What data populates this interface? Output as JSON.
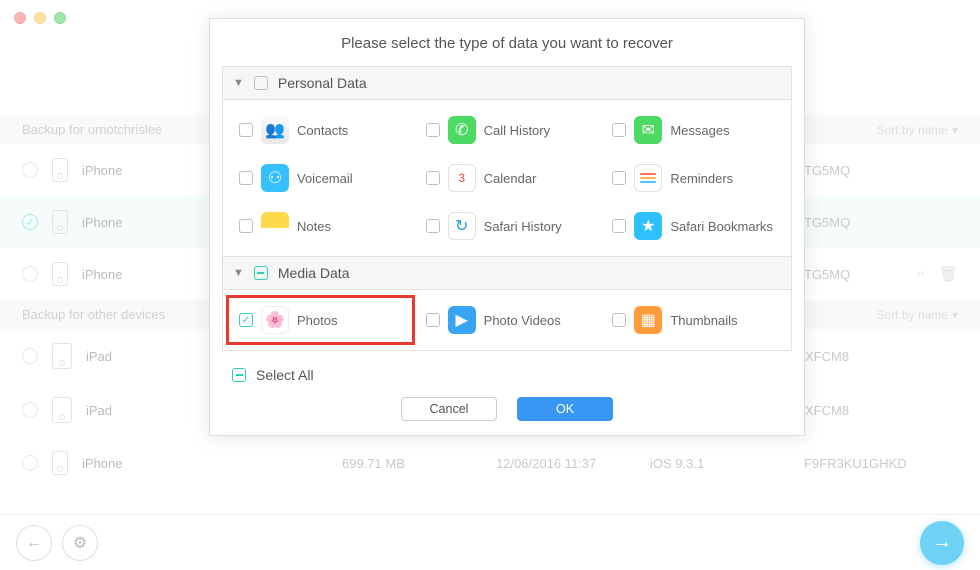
{
  "window": {
    "title": ""
  },
  "sections": {
    "user_label": "Backup for urnotchrislee",
    "other_label": "Backup for other devices",
    "sort_label": "Sort by name"
  },
  "rows": [
    {
      "name": "iPhone",
      "serial": "TG5MQ"
    },
    {
      "name": "iPhone",
      "serial": "TG5MQ"
    },
    {
      "name": "iPhone",
      "serial": "TG5MQ"
    },
    {
      "name": "iPad",
      "serial": "XFCM8"
    },
    {
      "name": "iPad",
      "serial": "XFCM8"
    }
  ],
  "full_row": {
    "name": "iPhone",
    "size": "699.71 MB",
    "date": "12/06/2016 11:37",
    "os": "iOS 9.3.1",
    "serial": "F9FR3KU1GHKD"
  },
  "dialog": {
    "title": "Please select the type of data you want to recover",
    "group_personal": "Personal Data",
    "group_media": "Media Data",
    "items": {
      "contacts": "Contacts",
      "call_history": "Call History",
      "messages": "Messages",
      "voicemail": "Voicemail",
      "calendar": "Calendar",
      "reminders": "Reminders",
      "notes": "Notes",
      "safari_history": "Safari History",
      "safari_bookmarks": "Safari Bookmarks",
      "photos": "Photos",
      "photo_videos": "Photo Videos",
      "thumbnails": "Thumbnails"
    },
    "calendar_day": "3",
    "select_all": "Select All",
    "cancel": "Cancel",
    "ok": "OK"
  }
}
